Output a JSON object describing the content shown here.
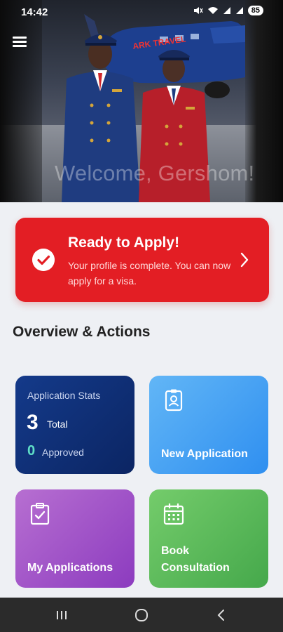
{
  "status_bar": {
    "time": "14:42",
    "battery": "85",
    "icons": [
      "mute-icon",
      "wifi-icon",
      "signal-icon",
      "signal-icon"
    ]
  },
  "hero": {
    "welcome_text": "Welcome, Gershom!",
    "plane_logo_text": "ARK TRAVEL"
  },
  "ready_banner": {
    "title": "Ready to Apply!",
    "message": "Your profile is complete. You can now apply for a visa.",
    "color": "#e31e24"
  },
  "section": {
    "title": "Overview & Actions"
  },
  "cards": {
    "stats": {
      "label": "Application Stats",
      "total_value": "3",
      "total_label": "Total",
      "approved_value": "0",
      "approved_label": "Approved"
    },
    "new_application": {
      "label": "New Application",
      "icon": "id-badge-icon"
    },
    "my_applications": {
      "label": "My Applications",
      "icon": "clipboard-check-icon"
    },
    "book_consultation": {
      "label_line1": "Book",
      "label_line2": "Consultation",
      "icon": "calendar-icon"
    }
  },
  "colors": {
    "stats_card": "#0b2563",
    "new_app_card": "#2f8ff0",
    "my_apps_card": "#8c3bbf",
    "book_card": "#45a84b",
    "approved_accent": "#5fdfc7"
  }
}
